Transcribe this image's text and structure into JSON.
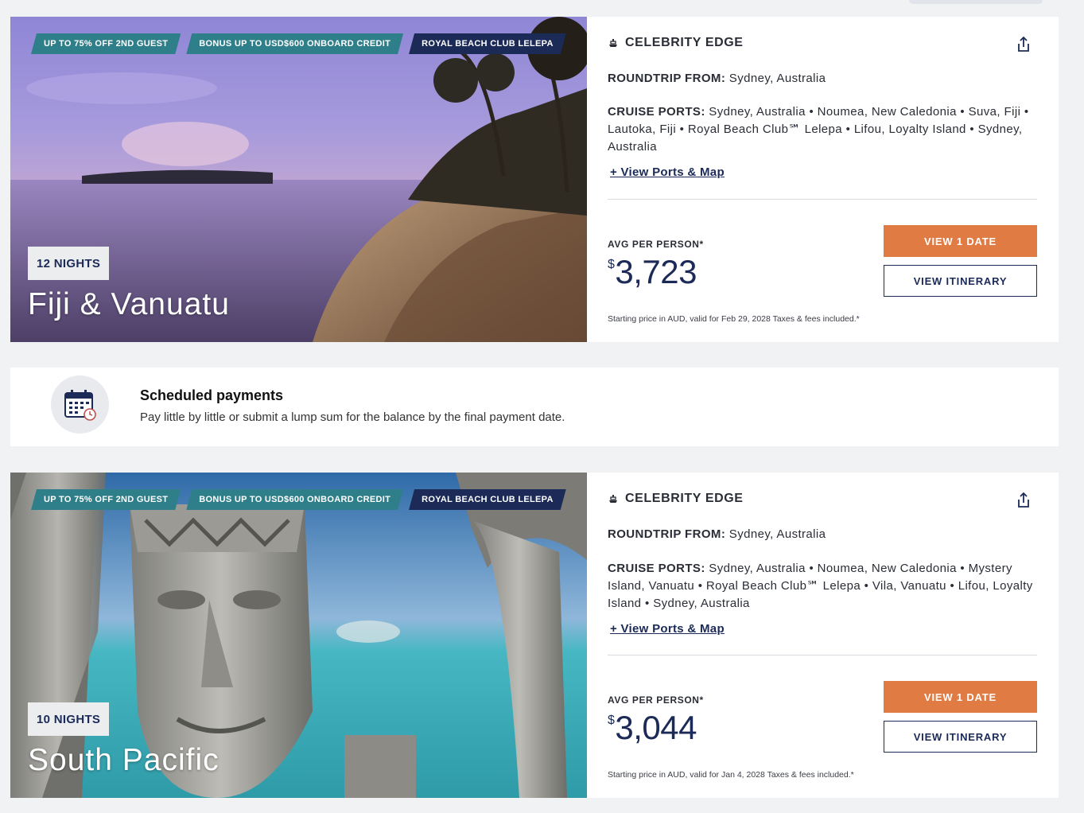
{
  "cruises": [
    {
      "ribbons": [
        "UP TO 75% OFF 2ND GUEST",
        "BONUS UP TO USD$600 ONBOARD CREDIT",
        "ROYAL BEACH CLUB LELEPA"
      ],
      "nights": "12 NIGHTS",
      "destination": "Fiji & Vanuatu",
      "ship": "CELEBRITY EDGE",
      "roundtrip_label": "ROUNDTRIP FROM:",
      "roundtrip_value": "Sydney, Australia",
      "ports_label": "CRUISE PORTS:",
      "ports_value": "Sydney, Australia • Noumea, New Caledonia • Suva, Fiji • Lautoka, Fiji • Royal Beach Club℠ Lelepa • Lifou, Loyalty Island • Sydney, Australia",
      "view_ports": "+ View Ports & Map",
      "avg_label": "AVG PER PERSON*",
      "currency": "$",
      "price": "3,723",
      "fine_print": "Starting price in AUD, valid for Feb 29, 2028 Taxes & fees included.*",
      "primary_button": "VIEW 1 DATE",
      "secondary_button": "VIEW ITINERARY"
    },
    {
      "ribbons": [
        "UP TO 75% OFF 2ND GUEST",
        "BONUS UP TO USD$600 ONBOARD CREDIT",
        "ROYAL BEACH CLUB LELEPA"
      ],
      "nights": "10 NIGHTS",
      "destination": "South Pacific",
      "ship": "CELEBRITY EDGE",
      "roundtrip_label": "ROUNDTRIP FROM:",
      "roundtrip_value": "Sydney, Australia",
      "ports_label": "CRUISE PORTS:",
      "ports_value": "Sydney, Australia • Noumea, New Caledonia • Mystery Island, Vanuatu • Royal Beach Club℠ Lelepa • Vila, Vanuatu • Lifou, Loyalty Island • Sydney, Australia",
      "view_ports": "+ View Ports & Map",
      "avg_label": "AVG PER PERSON*",
      "currency": "$",
      "price": "3,044",
      "fine_print": "Starting price in AUD, valid for Jan 4, 2028 Taxes & fees included.*",
      "primary_button": "VIEW 1 DATE",
      "secondary_button": "VIEW ITINERARY"
    }
  ],
  "banner": {
    "title": "Scheduled payments",
    "text": "Pay little by little or submit a lump sum for the balance by the final payment date.",
    "icon": "calendar-clock-icon"
  },
  "colors": {
    "navy": "#1b2a57",
    "teal": "#2f7f8a",
    "orange": "#e07b44",
    "page_bg": "#f1f2f4"
  }
}
